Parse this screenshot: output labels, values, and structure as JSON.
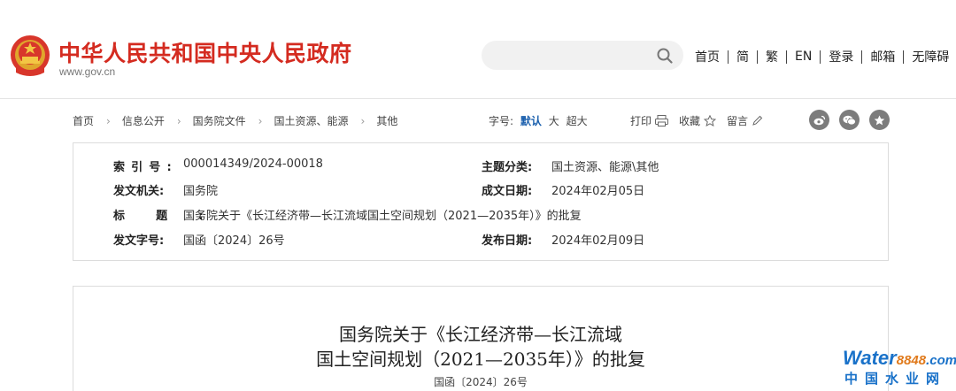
{
  "header": {
    "site_title": "中华人民共和国中央人民政府",
    "site_url": "www.gov.cn",
    "search_placeholder": "",
    "links": [
      "首页",
      "简",
      "繁",
      "EN",
      "登录",
      "邮箱",
      "无障碍"
    ]
  },
  "breadcrumb": [
    "首页",
    "信息公开",
    "国务院文件",
    "国土资源、能源",
    "其他"
  ],
  "font_size": {
    "label": "字号:",
    "options": [
      "默认",
      "大",
      "超大"
    ],
    "selected": "默认"
  },
  "tools": {
    "print": "打印",
    "favorite": "收藏",
    "comment": "留言"
  },
  "share_icons": [
    "weibo-icon",
    "wechat-icon",
    "favorite-star-icon"
  ],
  "info": {
    "index_label": "索引号:",
    "index_value": "000014349/2024-00018",
    "category_label": "主题分类:",
    "category_value": "国土资源、能源\\其他",
    "issuer_label": "发文机关:",
    "issuer_value": "国务院",
    "created_label": "成文日期:",
    "created_value": "2024年02月05日",
    "title_label": "标题:",
    "title_value": "国务院关于《长江经济带—长江流域国土空间规划（2021—2035年）》的批复",
    "docno_label": "发文字号:",
    "docno_value": "国函〔2024〕26号",
    "published_label": "发布日期:",
    "published_value": "2024年02月09日"
  },
  "document": {
    "title_line1": "国务院关于《长江经济带—长江流域",
    "title_line2": "国土空间规划（2021—2035年）》的批复",
    "doc_number": "国函〔2024〕26号"
  },
  "watermark": {
    "logo_word": "Water",
    "logo_num": "8848",
    "logo_suffix": ".com",
    "cn_text": "中国水业网"
  },
  "colors": {
    "brand_red": "#d42b20",
    "link_blue": "#1a5fad",
    "watermark_blue": "#1a72c9",
    "watermark_orange": "#e07a1c"
  }
}
